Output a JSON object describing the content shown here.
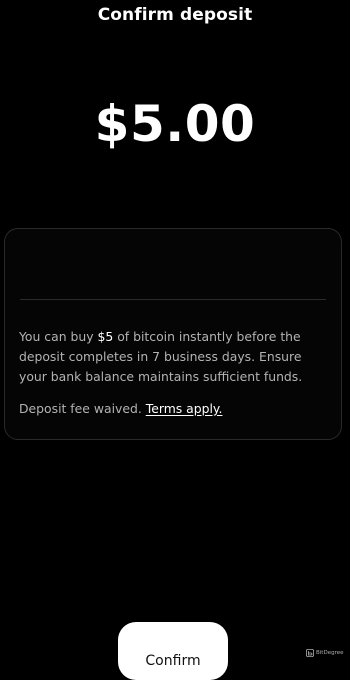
{
  "header": {
    "title": "Confirm deposit"
  },
  "deposit": {
    "amount": "$5.00"
  },
  "details": {
    "text_1": "You can buy ",
    "highlight_amount": "$5",
    "text_2": " of bitcoin instantly before the deposit completes in 7 business days. Ensure your bank balance maintains sufficient funds.",
    "fee_text": "Deposit fee waived. ",
    "terms_link": "Terms apply."
  },
  "actions": {
    "confirm_label": "Confirm"
  },
  "watermark": {
    "icon": "bitdegree-logo-icon",
    "text": "BitDegree"
  }
}
